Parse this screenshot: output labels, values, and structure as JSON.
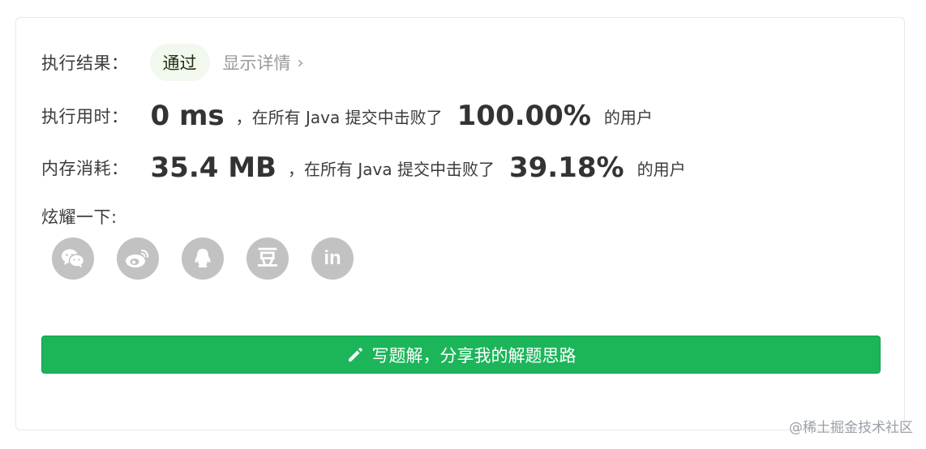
{
  "result": {
    "label": "执行结果：",
    "status": "通过",
    "details_link": "显示详情",
    "details_chevron": "›"
  },
  "runtime": {
    "label": "执行用时：",
    "value": "0 ms",
    "middle_text": "，在所有 Java 提交中击败了",
    "percent": "100.00%",
    "suffix": "的用户"
  },
  "memory": {
    "label": "内存消耗：",
    "value": "35.4 MB",
    "middle_text": "，在所有 Java 提交中击败了",
    "percent": "39.18%",
    "suffix": "的用户"
  },
  "share": {
    "label": "炫耀一下:",
    "buttons": [
      {
        "icon": "wechat-icon"
      },
      {
        "icon": "weibo-icon"
      },
      {
        "icon": "qq-icon"
      },
      {
        "icon": "douban-icon",
        "glyph": "豆"
      },
      {
        "icon": "linkedin-icon",
        "glyph": "in"
      }
    ]
  },
  "write_button": {
    "label": "写题解，分享我的解题思路",
    "icon": "pencil-icon"
  },
  "watermark": "@稀土掘金技术社区",
  "colors": {
    "accent_green": "#1cb55a",
    "badge_bg": "#f3f8ee",
    "icon_gray": "#c2c2c2"
  }
}
